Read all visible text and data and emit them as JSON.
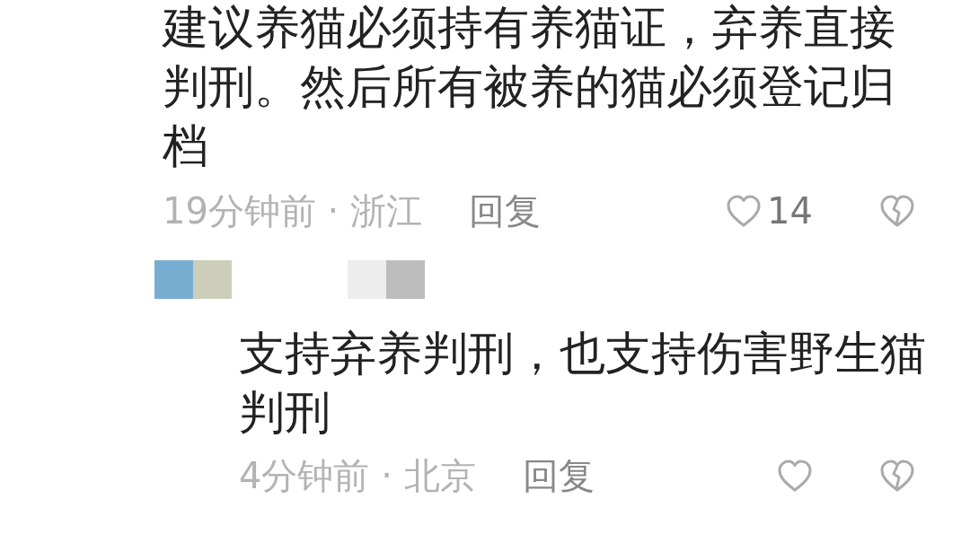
{
  "comments": [
    {
      "text": "建议养猫必须持有养猫证，弃养直接判刑。然后所有被养的猫必须登记归档",
      "meta": "19分钟前 · 浙江",
      "reply_label": "回复",
      "likes": "14",
      "replies": [
        {
          "text": "支持弃养判刑，也支持伤害野生猫判刑",
          "meta": "4分钟前 · 北京",
          "reply_label": "回复"
        }
      ]
    }
  ]
}
